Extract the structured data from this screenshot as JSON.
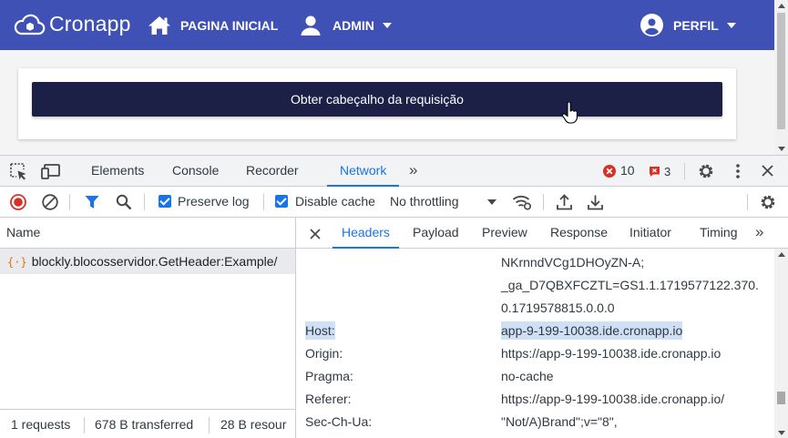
{
  "navbar": {
    "brand": "Cronapp",
    "home_label": "PAGINA INICIAL",
    "admin_label": "ADMIN",
    "profile_label": "PERFIL",
    "bg_color": "#3f51b5"
  },
  "page": {
    "button_label": "Obter cabeçalho da requisição",
    "button_color": "#1d2046"
  },
  "devtools": {
    "tabs": [
      "Elements",
      "Console",
      "Recorder",
      "Network"
    ],
    "active_tab": "Network",
    "errors_count": "10",
    "issues_count": "3",
    "toolbar": {
      "preserve_log_label": "Preserve log",
      "preserve_log_checked": true,
      "disable_cache_label": "Disable cache",
      "disable_cache_checked": true,
      "throttling_value": "No throttling"
    },
    "requests": {
      "column_header": "Name",
      "items": [
        "blockly.blocosservidor.GetHeader:Example/"
      ],
      "status": {
        "count": "1 requests",
        "transferred": "678 B transferred",
        "resources": "28 B resour"
      }
    },
    "detail": {
      "tabs": [
        "Headers",
        "Payload",
        "Preview",
        "Response",
        "Initiator",
        "Timing"
      ],
      "active_tab": "Headers",
      "cookie_lines": [
        "NKrnndVCg1DHOyZN-A;",
        "_ga_D7QBXFCZTL=GS1.1.1719577122.370.",
        "0.1719578815.0.0.0"
      ],
      "headers": [
        {
          "name": "Host:",
          "value": "app-9-199-10038.ide.cronapp.io",
          "highlighted": true
        },
        {
          "name": "Origin:",
          "value": "https://app-9-199-10038.ide.cronapp.io"
        },
        {
          "name": "Pragma:",
          "value": "no-cache"
        },
        {
          "name": "Referer:",
          "value": "https://app-9-199-10038.ide.cronapp.io/"
        },
        {
          "name": "Sec-Ch-Ua:",
          "value": "\"Not/A)Brand\";v=\"8\","
        }
      ]
    },
    "accent_color": "#1a73e8"
  }
}
